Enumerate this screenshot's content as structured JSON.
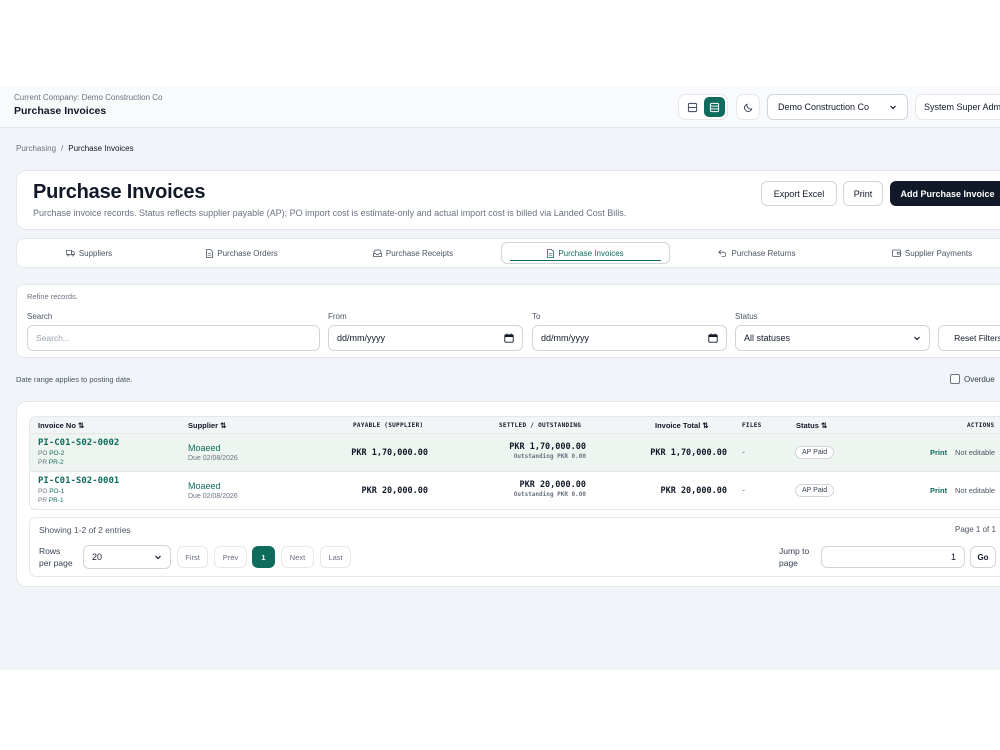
{
  "topbar": {
    "company_line": "Current Company: Demo Construction Co",
    "title": "Purchase Invoices",
    "company_select": "Demo Construction Co",
    "user": "System Super Admin"
  },
  "breadcrumb": {
    "parent": "Purchasing",
    "separator": "/",
    "current": "Purchase Invoices"
  },
  "header": {
    "title": "Purchase Invoices",
    "description": "Purchase invoice records. Status reflects supplier payable (AP); PO import cost is estimate-only and actual import cost is billed via Landed Cost Bills.",
    "export_label": "Export Excel",
    "print_label": "Print",
    "add_label": "Add Purchase Invoice"
  },
  "tabs": [
    {
      "label": "Suppliers",
      "icon": "truck-icon"
    },
    {
      "label": "Purchase Orders",
      "icon": "document-icon"
    },
    {
      "label": "Purchase Receipts",
      "icon": "inbox-icon"
    },
    {
      "label": "Purchase Invoices",
      "icon": "document-icon",
      "active": true
    },
    {
      "label": "Purchase Returns",
      "icon": "undo-icon"
    },
    {
      "label": "Supplier Payments",
      "icon": "wallet-icon"
    }
  ],
  "filters": {
    "refine": "Refine records.",
    "search_label": "Search",
    "search_placeholder": "Search...",
    "from_label": "From",
    "from_value": "dd/mm/yyyy",
    "to_label": "To",
    "to_value": "dd/mm/yyyy",
    "status_label": "Status",
    "status_value": "All statuses",
    "reset_label": "Reset Filters"
  },
  "range_note": "Date range applies to posting date.",
  "overdue_label": "Overdue",
  "table": {
    "headers": {
      "invoice_no": "Invoice No",
      "supplier": "Supplier",
      "payable": "PAYABLE (SUPPLIER)",
      "settled": "SETTLED / OUTSTANDING",
      "invoice_total": "Invoice Total",
      "files": "FILES",
      "status": "Status",
      "actions": "ACTIONS"
    },
    "rows": [
      {
        "invoice_no": "PI-C01-S02-0002",
        "po_label": "PO",
        "po": "PO-2",
        "pr_label": "PR",
        "pr": "PR-2",
        "supplier": "Moaeed",
        "due": "Due 02/08/2026",
        "payable": "PKR 1,70,000.00",
        "settled": "PKR 1,70,000.00",
        "outstanding": "Outstanding PKR 0.00",
        "invoice_total": "PKR 1,70,000.00",
        "files": "-",
        "status": "AP Paid",
        "print": "Print",
        "edit_note": "Not editable"
      },
      {
        "invoice_no": "PI-C01-S02-0001",
        "po_label": "PO",
        "po": "PO-1",
        "pr_label": "PR",
        "pr": "PR-1",
        "supplier": "Moaeed",
        "due": "Due 02/08/2026",
        "payable": "PKR 20,000.00",
        "settled": "PKR 20,000.00",
        "outstanding": "Outstanding PKR 0.00",
        "invoice_total": "PKR 20,000.00",
        "files": "-",
        "status": "AP Paid",
        "print": "Print",
        "edit_note": "Not editable"
      }
    ]
  },
  "pagination": {
    "showing": "Showing 1-2 of 2 entries",
    "page_of": "Page 1 of 1",
    "rows_per_page_line1": "Rows",
    "rows_per_page_line2": "per page",
    "rows_per_page_value": "20",
    "first": "First",
    "prev": "Prev",
    "current": "1",
    "next": "Next",
    "last": "Last",
    "jump_line1": "Jump to",
    "jump_line2": "page",
    "jump_value": "1",
    "go": "Go"
  },
  "colors": {
    "accent": "#0f6b5c",
    "dark_button": "#111827",
    "app_bg": "#f1f4f8"
  }
}
